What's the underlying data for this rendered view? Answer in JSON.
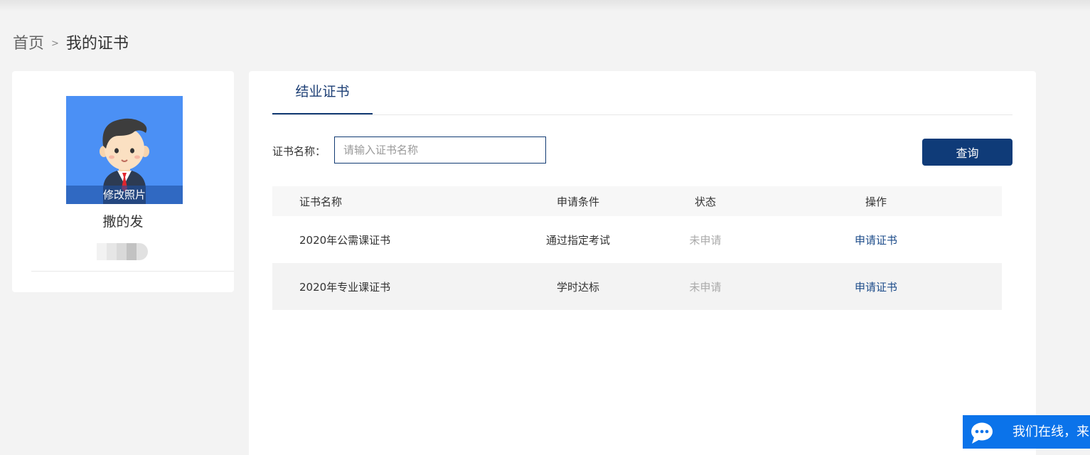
{
  "breadcrumb": {
    "home": "首页",
    "separator": ">",
    "current": "我的证书"
  },
  "profile": {
    "edit_photo_label": "修改照片",
    "name": "撒的发"
  },
  "tabs": [
    {
      "label": "结业证书",
      "active": true
    }
  ],
  "search": {
    "label": "证书名称：",
    "placeholder": "请输入证书名称",
    "value": "",
    "button_label": "查询"
  },
  "table": {
    "headers": {
      "name": "证书名称",
      "condition": "申请条件",
      "status": "状态",
      "action": "操作"
    },
    "rows": [
      {
        "name": "2020年公需课证书",
        "condition": "通过指定考试",
        "status": "未申请",
        "action": "申请证书"
      },
      {
        "name": "2020年专业课证书",
        "condition": "学时达标",
        "status": "未申请",
        "action": "申请证书"
      }
    ]
  },
  "chat": {
    "icon": "chat-bubble-icon",
    "text": "我们在线，来"
  },
  "colors": {
    "primary": "#0f3b78",
    "avatar_bg": "#4b90f5",
    "chat_bg": "#0b73ea",
    "status_gray": "#aaaaaa",
    "link": "#1d4c8a"
  }
}
